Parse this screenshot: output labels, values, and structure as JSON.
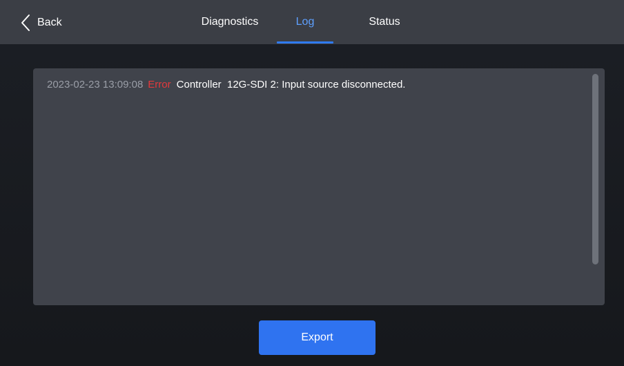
{
  "header": {
    "back_label": "Back",
    "tabs": [
      {
        "label": "Diagnostics",
        "active": false
      },
      {
        "label": "Log",
        "active": true
      },
      {
        "label": "Status",
        "active": false
      }
    ]
  },
  "log": {
    "entries": [
      {
        "timestamp": "2023-02-23 13:09:08",
        "level": "Error",
        "message": "Controller  12G-SDI 2: Input source disconnected."
      }
    ]
  },
  "actions": {
    "export_label": "Export"
  },
  "icons": {
    "back": "chevron-left-icon"
  },
  "colors": {
    "accent": "#2f73f0",
    "active_tab": "#5ea0ff",
    "error": "#e4393c",
    "topbar": "#3b3e45",
    "panel": "#40434b"
  }
}
